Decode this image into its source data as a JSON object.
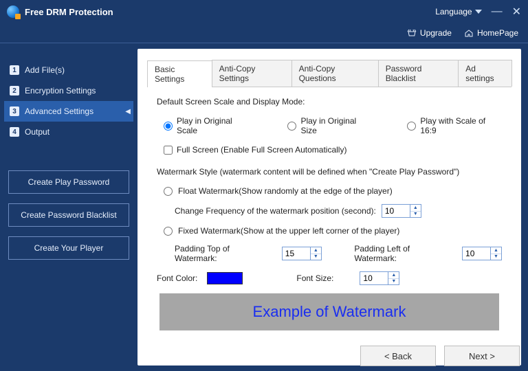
{
  "app": {
    "title": "Free DRM Protection",
    "language_label": "Language"
  },
  "toolbar": {
    "upgrade": "Upgrade",
    "homepage": "HomePage"
  },
  "sidebar": {
    "steps": [
      {
        "n": "1",
        "label": "Add File(s)"
      },
      {
        "n": "2",
        "label": "Encryption Settings"
      },
      {
        "n": "3",
        "label": "Advanced Settings"
      },
      {
        "n": "4",
        "label": "Output"
      }
    ],
    "buttons": {
      "create_password": "Create Play Password",
      "create_blacklist": "Create Password Blacklist",
      "create_player": "Create Your Player"
    }
  },
  "tabs": [
    "Basic Settings",
    "Anti-Copy Settings",
    "Anti-Copy Questions",
    "Password Blacklist",
    "Ad settings"
  ],
  "basic": {
    "scale_title": "Default Screen Scale and Display Mode:",
    "opt_original_scale": "Play in Original Scale",
    "opt_original_size": "Play in Original Size",
    "opt_169": "Play with Scale of 16:9",
    "fullscreen": "Full Screen (Enable Full Screen Automatically)",
    "wm_title": "Watermark Style (watermark content will be defined when \"Create Play Password\")",
    "float_label": "Float Watermark(Show randomly at the edge of the player)",
    "change_freq_label": "Change Frequency of the watermark position (second):",
    "change_freq_value": "10",
    "fixed_label": "Fixed Watermark(Show at the upper left corner of the player)",
    "pad_top_label": "Padding Top of Watermark:",
    "pad_top_value": "15",
    "pad_left_label": "Padding Left of Watermark:",
    "pad_left_value": "10",
    "font_color_label": "Font Color:",
    "font_color": "#0000ff",
    "font_size_label": "Font Size:",
    "font_size_value": "10",
    "example": "Example of Watermark"
  },
  "footer": {
    "back": "<  Back",
    "next": "Next  >"
  }
}
